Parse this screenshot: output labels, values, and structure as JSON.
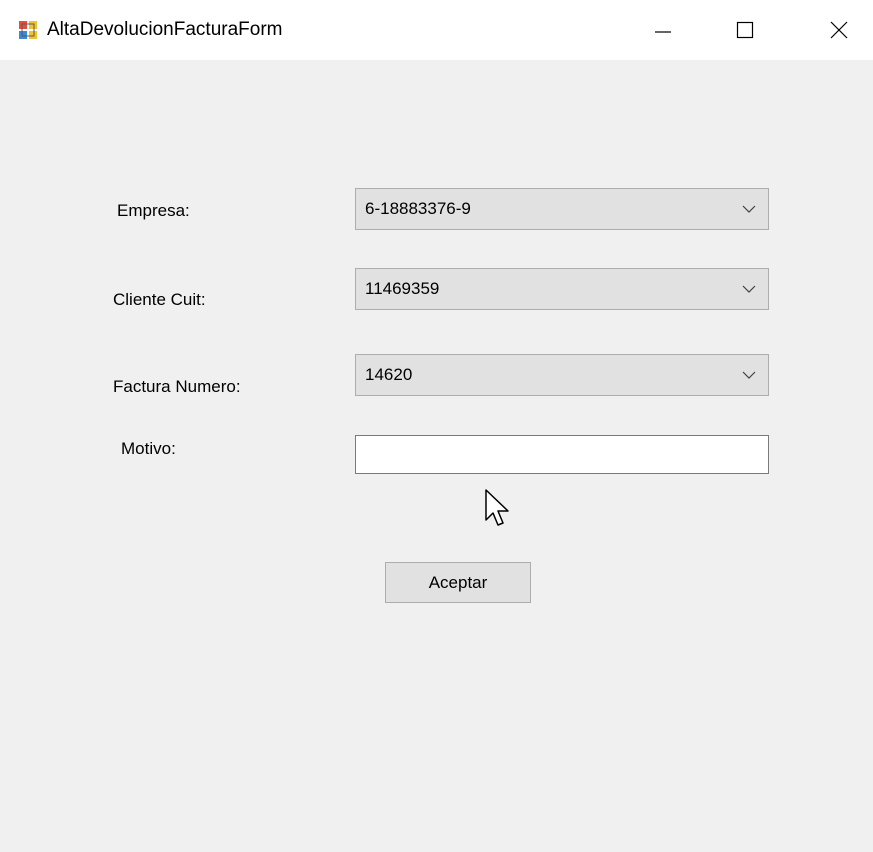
{
  "window": {
    "title": "AltaDevolucionFacturaForm",
    "controls": [
      "minimize",
      "maximize",
      "close"
    ]
  },
  "form": {
    "empresa": {
      "label": "Empresa:",
      "value": "6-18883376-9"
    },
    "cliente_cuit": {
      "label": "Cliente Cuit:",
      "value": "11469359"
    },
    "factura_numero": {
      "label": "Factura Numero:",
      "value": "14620"
    },
    "motivo": {
      "label": "Motivo:",
      "value": ""
    },
    "submit_label": "Aceptar"
  },
  "colors": {
    "client_background": "#f0f0f0",
    "control_background": "#e1e1e1",
    "control_border": "#adadad"
  },
  "icons": {
    "app": "windows-form-icon",
    "minimize": "minimize-icon",
    "maximize": "maximize-icon",
    "close": "close-icon",
    "dropdown": "chevron-down-icon",
    "cursor": "mouse-pointer-icon"
  }
}
